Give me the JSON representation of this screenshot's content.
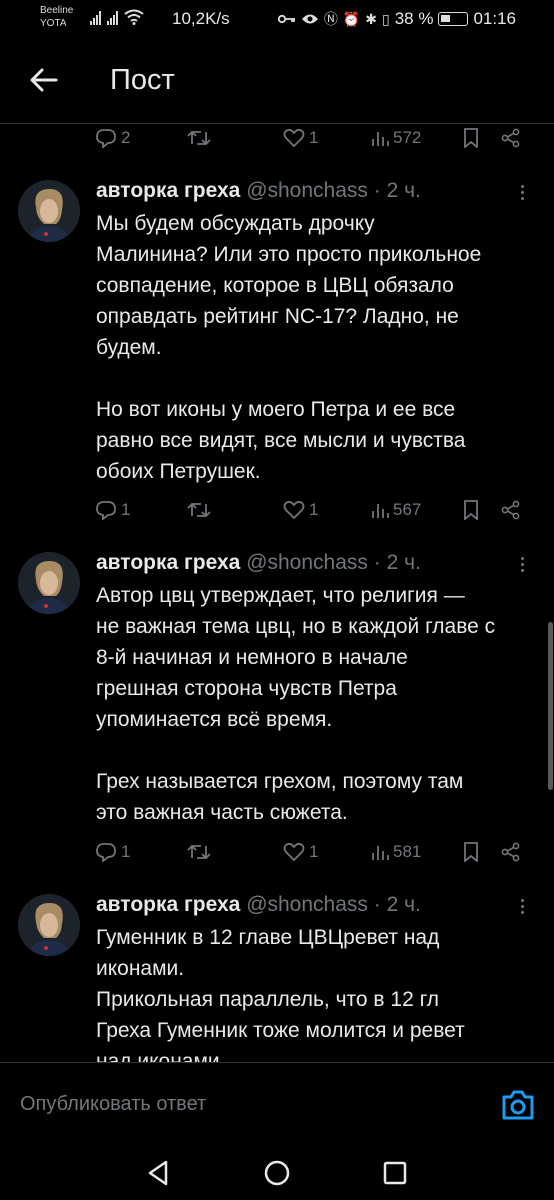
{
  "status_bar": {
    "carrier_top": "Beeline",
    "carrier_bottom": "YOTA",
    "speed": "10,2K/s",
    "battery": "38 %",
    "time": "01:16"
  },
  "header": {
    "title": "Пост",
    "back_icon": "arrow-left-icon"
  },
  "top_actions": {
    "replies": "2",
    "retweets": "",
    "likes": "1",
    "views": "572"
  },
  "tweets": [
    {
      "author": "авторка греха",
      "handle": "@shonchass",
      "time": "· 2 ч.",
      "text": "Мы будем обсуждать дрочку\nМалинина? Или это просто прикольное\nсовпадение, которое в ЦВЦ обязало\nоправдать рейтинг NC-17? Ладно, не\nбудем.\n\nНо вот иконы у моего Петра и ее все\nравно все видят, все мысли и чувства\nобоих Петрушек.",
      "replies": "1",
      "retweets": "",
      "likes": "1",
      "views": "567"
    },
    {
      "author": "авторка греха",
      "handle": "@shonchass",
      "time": "· 2 ч.",
      "text": "Автор цвц утверждает, что религия —\nне важная тема цвц, но в каждой главе с\n8-й начиная и немного в начале\nгрешная сторона чувств Петра\nупоминается всё время.\n\nГрех называется грехом, поэтому там\nэто важная часть сюжета.",
      "replies": "1",
      "retweets": "",
      "likes": "1",
      "views": "581"
    },
    {
      "author": "авторка греха",
      "handle": "@shonchass",
      "time": "· 2 ч.",
      "text": "Гуменник в 12 главе ЦВЦревет над\nиконами.\nПрикольная параллель, что в 12 гл\nГреха Гуменник тоже молится и ревет\nнад иконами"
    }
  ],
  "reply": {
    "placeholder": "Опубликовать ответ"
  },
  "colors": {
    "background": "#000000",
    "text": "#e7e9ea",
    "muted": "#71767b",
    "accent": "#1d9bf0"
  }
}
